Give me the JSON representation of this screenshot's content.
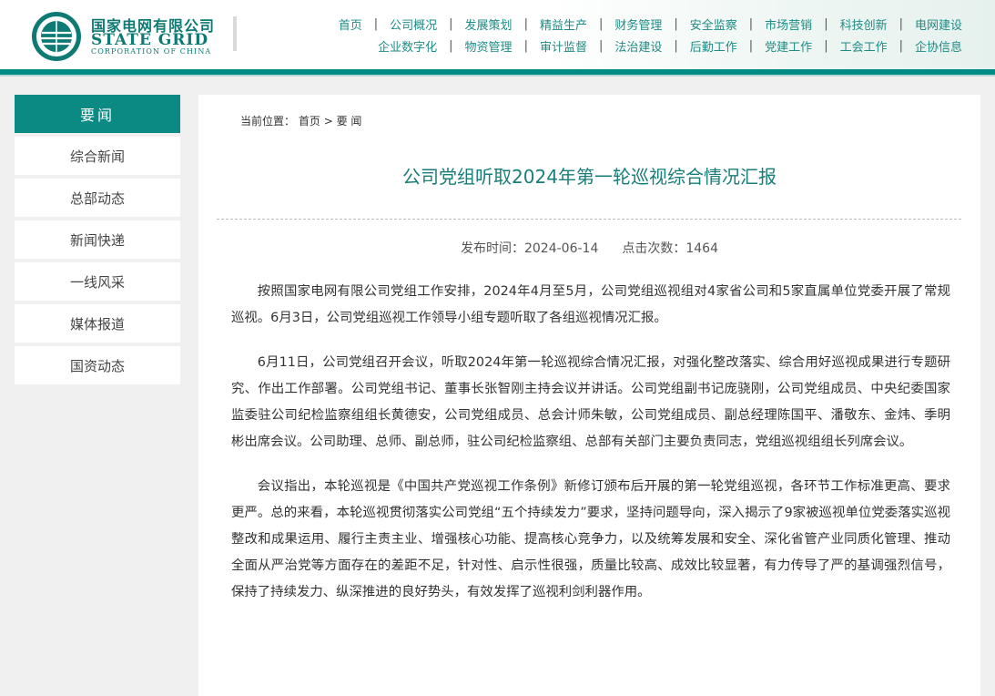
{
  "brand": {
    "cn": "国家电网有限公司",
    "en": "STATE GRID",
    "en_sub": "CORPORATION OF CHINA",
    "color": "#0f7a74"
  },
  "nav": {
    "row1": [
      "首页",
      "公司概况",
      "发展策划",
      "精益生产",
      "财务管理",
      "安全监察",
      "市场营销",
      "科技创新",
      "电网建设"
    ],
    "row2": [
      "企业数字化",
      "物资管理",
      "审计监督",
      "法治建设",
      "后勤工作",
      "党建工作",
      "工会工作",
      "企协信息"
    ]
  },
  "sidebar": {
    "header": "要闻",
    "items": [
      "综合新闻",
      "总部动态",
      "新闻快递",
      "一线风采",
      "媒体报道",
      "国资动态"
    ]
  },
  "breadcrumb": {
    "prefix": "当前位置：",
    "home": "首页",
    "sep": ">",
    "current": "要 闻"
  },
  "article": {
    "title": "公司党组听取2024年第一轮巡视综合情况汇报",
    "publish_label": "发布时间：2024-06-14",
    "clicks_label": "点击次数：1464",
    "paragraphs": [
      "按照国家电网有限公司党组工作安排，2024年4月至5月，公司党组巡视组对4家省公司和5家直属单位党委开展了常规巡视。6月3日，公司党组巡视工作领导小组专题听取了各组巡视情况汇报。",
      "6月11日，公司党组召开会议，听取2024年第一轮巡视综合情况汇报，对强化整改落实、综合用好巡视成果进行专题研究、作出工作部署。公司党组书记、董事长张智刚主持会议并讲话。公司党组副书记庞骁刚，公司党组成员、中央纪委国家监委驻公司纪检监察组组长黄德安，公司党组成员、总会计师朱敏，公司党组成员、副总经理陈国平、潘敬东、金炜、季明彬出席会议。公司助理、总师、副总师，驻公司纪检监察组、总部有关部门主要负责同志，党组巡视组组长列席会议。",
      "会议指出，本轮巡视是《中国共产党巡视工作条例》新修订颁布后开展的第一轮党组巡视，各环节工作标准更高、要求更严。总的来看，本轮巡视贯彻落实公司党组“五个持续发力”要求，坚持问题导向，深入揭示了9家被巡视单位党委落实巡视整改和成果运用、履行主责主业、增强核心功能、提高核心竞争力，以及统筹发展和安全、深化省管产业同质化管理、推动全面从严治党等方面存在的差距不足，针对性、启示性很强，质量比较高、成效比较显著，有力传导了严的基调强烈信号，保持了持续发力、纵深推进的良好势头，有效发挥了巡视利剑利器作用。"
    ]
  },
  "colors": {
    "accent": "#008b84",
    "sidebar_active": "#0b8a84",
    "title": "#1a7e78"
  }
}
